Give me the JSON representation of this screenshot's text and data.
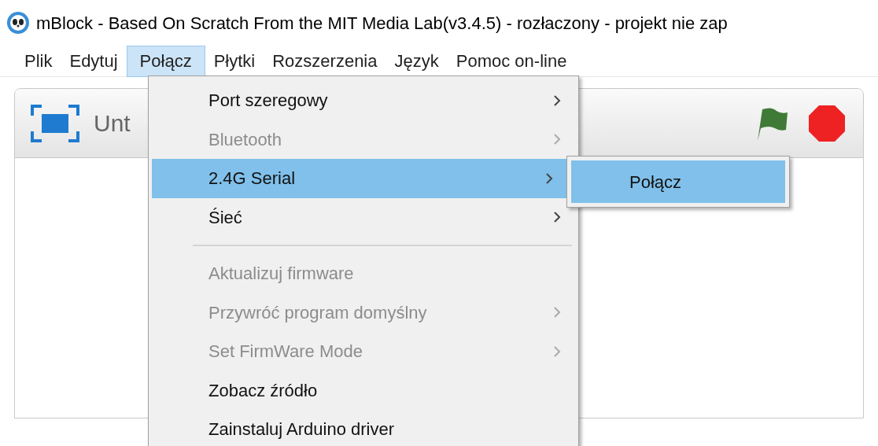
{
  "window": {
    "title": "mBlock - Based On Scratch From the MIT Media Lab(v3.4.5) - rozłaczony - projekt nie zap"
  },
  "menubar": [
    {
      "label": "Plik",
      "selected": false
    },
    {
      "label": "Edytuj",
      "selected": false
    },
    {
      "label": "Połącz",
      "selected": true
    },
    {
      "label": "Płytki",
      "selected": false
    },
    {
      "label": "Rozszerzenia",
      "selected": false
    },
    {
      "label": "Język",
      "selected": false
    },
    {
      "label": "Pomoc on-line",
      "selected": false
    }
  ],
  "stage": {
    "title": "Unt"
  },
  "menu": [
    {
      "kind": "item",
      "label": "Port szeregowy",
      "disabled": false,
      "submenu": true,
      "selected": false
    },
    {
      "kind": "item",
      "label": "Bluetooth",
      "disabled": true,
      "submenu": true,
      "selected": false
    },
    {
      "kind": "item",
      "label": "2.4G Serial",
      "disabled": false,
      "submenu": true,
      "selected": true
    },
    {
      "kind": "item",
      "label": "Śieć",
      "disabled": false,
      "submenu": true,
      "selected": false
    },
    {
      "kind": "separator"
    },
    {
      "kind": "item",
      "label": "Aktualizuj firmware",
      "disabled": true,
      "submenu": false,
      "selected": false
    },
    {
      "kind": "item",
      "label": "Przywróć program domyślny",
      "disabled": true,
      "submenu": true,
      "selected": false
    },
    {
      "kind": "item",
      "label": "Set FirmWare Mode",
      "disabled": true,
      "submenu": true,
      "selected": false
    },
    {
      "kind": "item",
      "label": "Zobacz źródło",
      "disabled": false,
      "submenu": false,
      "selected": false
    },
    {
      "kind": "item",
      "label": "Zainstaluj Arduino driver",
      "disabled": false,
      "submenu": false,
      "selected": false
    }
  ],
  "submenu": [
    {
      "label": "Połącz",
      "selected": true
    }
  ]
}
